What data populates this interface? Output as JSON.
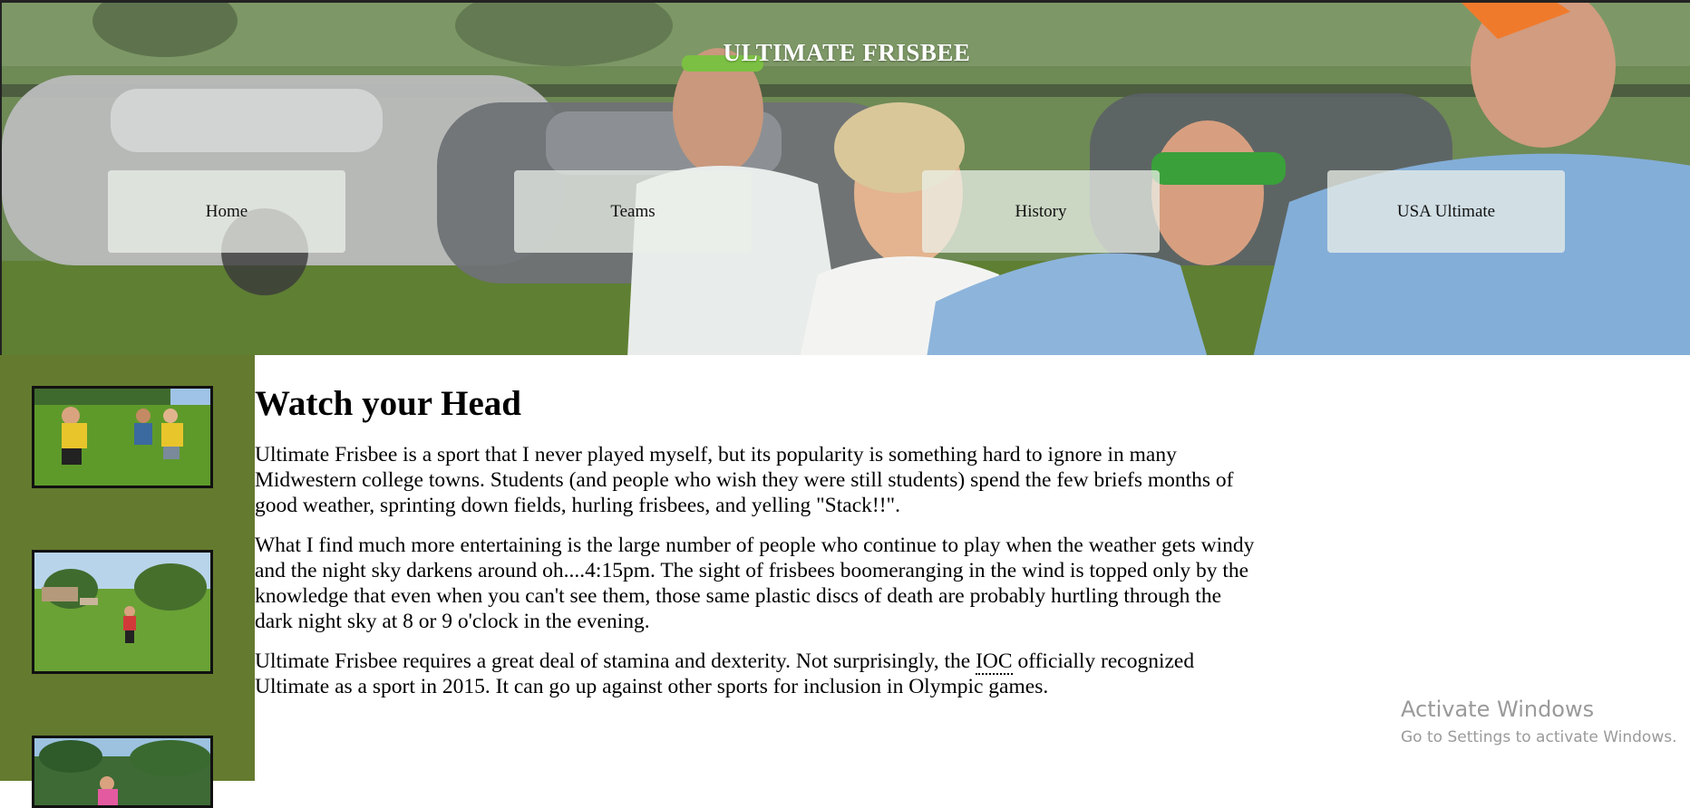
{
  "header": {
    "site_title": "ULTIMATE FRISBEE",
    "nav": [
      {
        "label": "Home"
      },
      {
        "label": "Teams"
      },
      {
        "label": "History"
      },
      {
        "label": "USA Ultimate"
      }
    ]
  },
  "sidebar": {
    "thumbnails": [
      {
        "depicts": "players-marking-thrower"
      },
      {
        "depicts": "player-throwing-in-park"
      },
      {
        "depicts": "player-catching-disc"
      }
    ]
  },
  "article": {
    "heading": "Watch your Head",
    "paragraph_1": "Ultimate Frisbee is a sport that I never played myself, but its popularity is something hard to ignore in many Midwestern college towns. Students (and people who wish they were still students) spend the few briefs months of good weather, sprinting down fields, hurling frisbees, and yelling \"Stack!!\".",
    "paragraph_2": "What I find much more entertaining is the large number of people who continue to play when the weather gets windy and the night sky darkens around oh....4:15pm. The sight of frisbees boomeranging in the wind is topped only by the knowledge that even when you can't see them, those same plastic discs of death are probably hurtling through the dark night sky at 8 or 9 o'clock in the evening.",
    "paragraph_3_before": "Ultimate Frisbee requires a great deal of stamina and dexterity. Not surprisingly, the ",
    "paragraph_3_abbr": "IOC",
    "paragraph_3_after": " officially recognized Ultimate as a sport in 2015. It can go up against other sports for inclusion in Olympic games."
  },
  "watermark": {
    "title": "Activate Windows",
    "subtitle": "Go to Settings to activate Windows."
  },
  "colors": {
    "sidebar_bg": "#647a2f",
    "nav_button_bg": "rgba(236,240,234,0.74)",
    "watermark_text": "#9a9a9a"
  }
}
